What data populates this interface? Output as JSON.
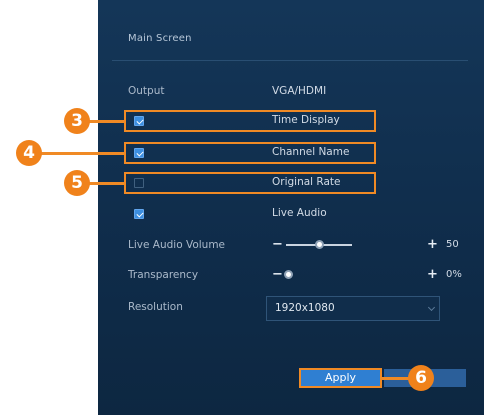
{
  "panel": {
    "title": "Main Screen"
  },
  "rows": {
    "output": {
      "label": "Output",
      "value": "VGA/HDMI"
    },
    "time_display": {
      "label": "Time Display",
      "checked": true
    },
    "channel_name": {
      "label": "Channel Name",
      "checked": true
    },
    "original_rate": {
      "label": "Original Rate",
      "checked": false
    },
    "live_audio": {
      "label": "Live Audio",
      "checked": true
    },
    "live_audio_volume": {
      "label": "Live Audio Volume",
      "minus": "−",
      "plus": "+",
      "value": "50",
      "level_fraction": 0.5
    },
    "transparency": {
      "label": "Transparency",
      "minus": "−",
      "plus": "+",
      "value": "0%",
      "level_fraction": 0.0
    },
    "resolution": {
      "label": "Resolution",
      "value": "1920x1080"
    }
  },
  "buttons": {
    "apply_label": "Apply"
  },
  "callouts": [
    "3",
    "4",
    "5",
    "6"
  ],
  "colors": {
    "panel_bg": "#143658",
    "callout": "#f08a25",
    "checkbox_checked": "#3d8fe0",
    "apply_button": "#2f7fd2"
  },
  "icons": {
    "checkbox_checked": "checkbox-checked-icon",
    "checkbox_unchecked": "checkbox-unchecked-icon",
    "dropdown_caret": "chevron-down-icon"
  }
}
